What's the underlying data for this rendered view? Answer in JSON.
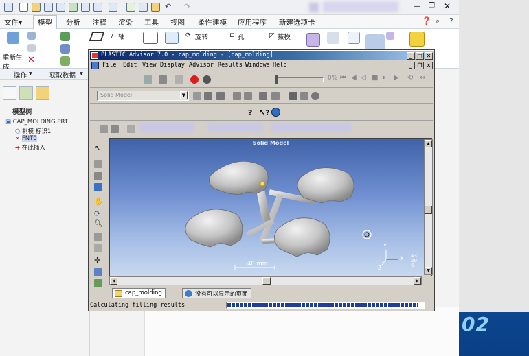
{
  "creo": {
    "menu_tabs": [
      "文件",
      "模型",
      "分析",
      "注释",
      "渲染",
      "工具",
      "视图",
      "柔性建模",
      "应用程序",
      "新建选项卡"
    ],
    "file_tab_suffix": "▾",
    "ribbon": {
      "regen_label": "重新生成",
      "axis_label": "轴",
      "rotate_label": "旋转",
      "hole_label": "孔",
      "draft_label": "拔模"
    },
    "groups": [
      "操作",
      "获取数据"
    ],
    "tree_header": "模型树",
    "tree_items": [
      "CAP_MOLDING.PRT",
      "制模 标识1",
      "FNT0",
      "在此插入"
    ]
  },
  "pa": {
    "title": "PLASTIC Advisor 7.0 - cap_molding - [cap_molding]",
    "menu": [
      "File",
      "Edit",
      "View",
      "Display",
      "Advisor",
      "Results",
      "Windows",
      "Help"
    ],
    "model_select": "Solid Model",
    "viewport_title": "Solid Model",
    "scale_label": "40 mm",
    "axes": {
      "y": "Y",
      "x": "X",
      "z": "Z",
      "readout": [
        "43",
        "20",
        "6"
      ]
    },
    "tabs": [
      "cap_molding",
      "没有可以显示的页面"
    ],
    "status_text": "Calculating filling results",
    "progress_fraction": 0.97
  },
  "side_number": "02",
  "colors": {
    "titlebar": "#0a246a",
    "progress_block": "#1f3f9a",
    "viewport_top": "#3f62a8",
    "part_gray": "#c8c8c8"
  }
}
